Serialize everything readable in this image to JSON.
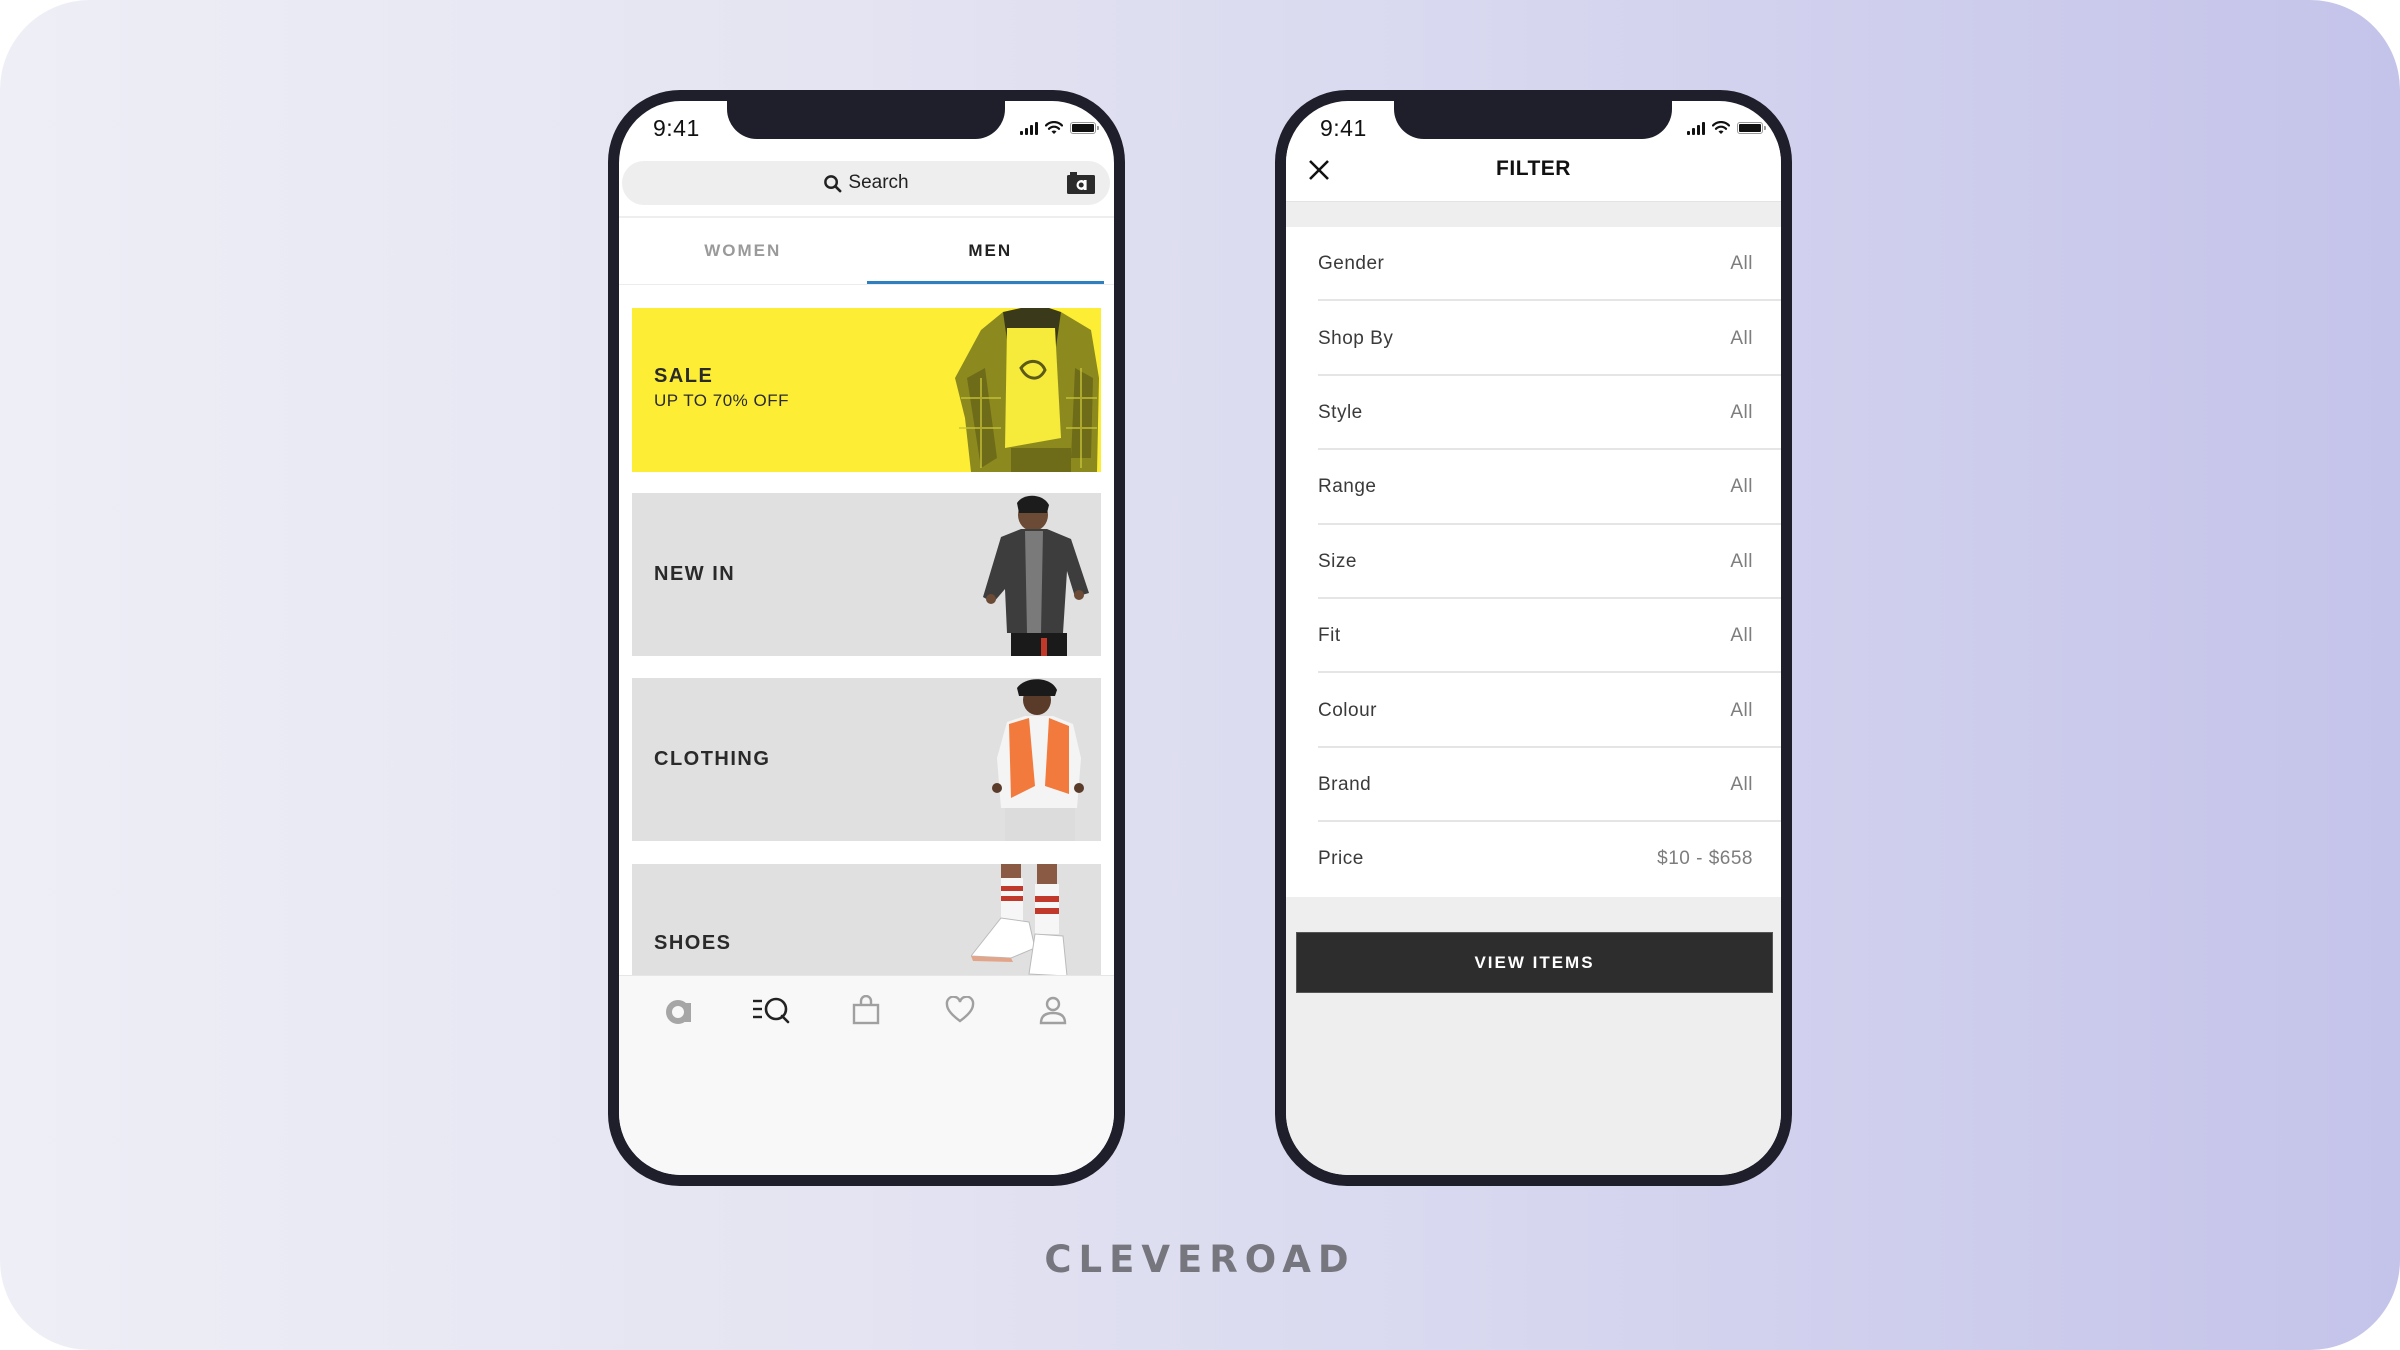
{
  "colors": {
    "accent_tab_underline": "#2e7fc0",
    "sale_banner": "#fdee35",
    "card_gray": "#e0e0e0",
    "phone_frame": "#1f1f2b",
    "primary_button": "#2d2d2d"
  },
  "left_phone": {
    "status_bar": {
      "time": "9:41",
      "icons": [
        "cellular-signal-icon",
        "wifi-icon",
        "battery-icon"
      ]
    },
    "search": {
      "placeholder": "Search",
      "icon": "search-icon",
      "camera_icon": "visual-search-camera-icon"
    },
    "tabs": [
      {
        "label": "WOMEN",
        "active": false
      },
      {
        "label": "MEN",
        "active": true
      }
    ],
    "categories": [
      {
        "title": "SALE",
        "subtitle": "UP TO 70% OFF",
        "image": "model-yellow-plaid-jacket"
      },
      {
        "title": "NEW IN",
        "image": "model-denim-jacket"
      },
      {
        "title": "CLOTHING",
        "image": "model-orange-vest"
      },
      {
        "title": "SHOES",
        "image": "sneakers-striped-socks"
      }
    ],
    "bottom_nav": [
      {
        "name": "home",
        "icon": "brand-a-icon",
        "active": false
      },
      {
        "name": "search",
        "icon": "search-list-icon",
        "active": true
      },
      {
        "name": "bag",
        "icon": "shopping-bag-icon",
        "active": false
      },
      {
        "name": "saved",
        "icon": "heart-icon",
        "active": false
      },
      {
        "name": "account",
        "icon": "user-icon",
        "active": false
      }
    ]
  },
  "right_phone": {
    "status_bar": {
      "time": "9:41",
      "icons": [
        "cellular-signal-icon",
        "wifi-icon",
        "battery-icon"
      ]
    },
    "header": {
      "title": "FILTER",
      "close_icon": "close-icon"
    },
    "filters": [
      {
        "name": "Gender",
        "value": "All"
      },
      {
        "name": "Shop By",
        "value": "All"
      },
      {
        "name": "Style",
        "value": "All"
      },
      {
        "name": "Range",
        "value": "All"
      },
      {
        "name": "Size",
        "value": "All"
      },
      {
        "name": "Fit",
        "value": "All"
      },
      {
        "name": "Colour",
        "value": "All"
      },
      {
        "name": "Brand",
        "value": "All"
      },
      {
        "name": "Price",
        "value": "$10 - $658"
      }
    ],
    "view_button_label": "VIEW ITEMS"
  },
  "footer": {
    "brand": "CLEVEROAD"
  }
}
